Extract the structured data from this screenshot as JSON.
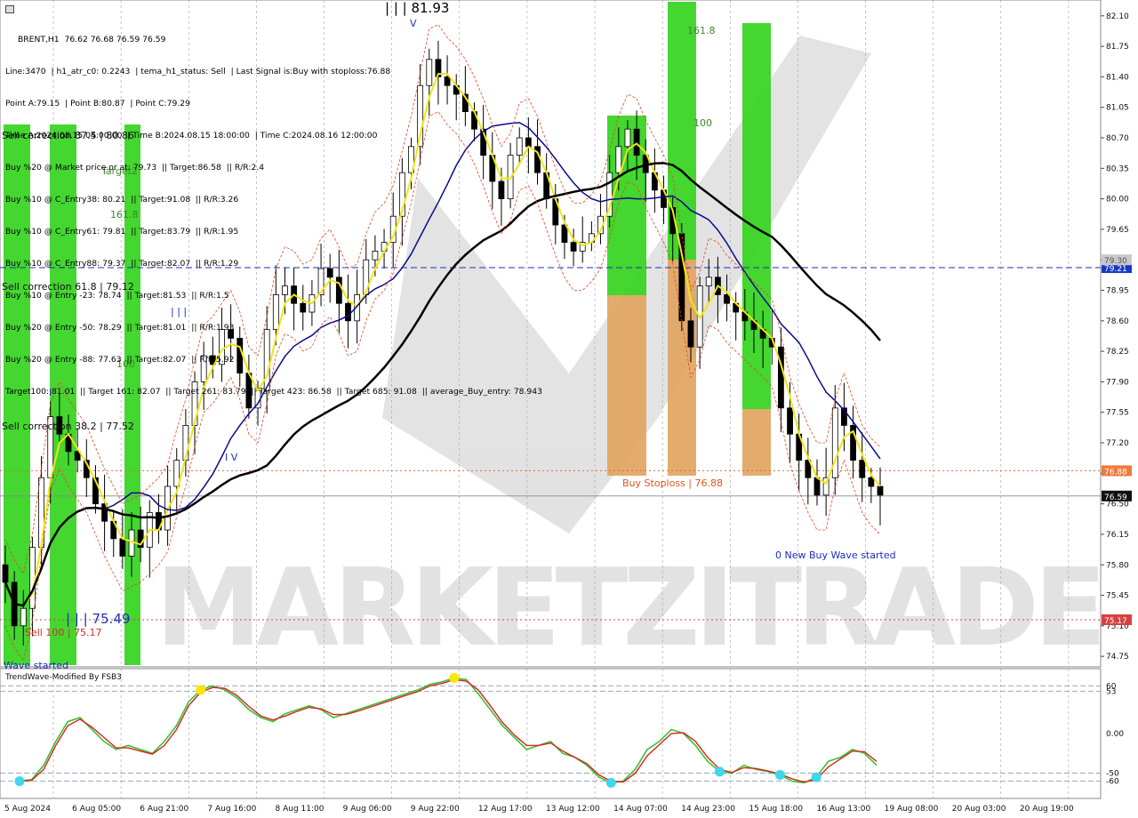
{
  "info_lines": [
    "BRENT,H1  76.62 76.68 76.59 76.59",
    "Line:3470  | h1_atr_c0: 0.2243  | tema_h1_status: Sell  | Last Signal is:Buy with stoploss:76.88",
    "Point A:79.15  | Point B:80.87  | Point C:79.29",
    "Time A:2024.08.15 04:00:00  | Time B:2024.08.15 18:00:00  | Time C:2024.08.16 12:00:00",
    "Buy %20 @ Market price or at: 79.73  || Target:86.58  || R/R:2.4",
    "Buy %10 @ C_Entry38: 80.21  || Target:91.08  || R/R:3.26",
    "Buy %10 @ C_Entry61: 79.81  || Target:83.79  || R/R:1.95",
    "Buy %10 @ C_Entry88: 79.37  || Target:82.07  || R/R:1.29",
    "Buy %10 @ Entry -23: 78.74  || Target:81.53  || R/R:1.5",
    "Buy %20 @ Entry -50: 78.29  || Target:81.01  || R/R:1.93",
    "Buy %20 @ Entry -88: 77.63  || Target:82.07  || R/R:5.92",
    "Target100: 81.01  || Target 161: 82.07  || Target 261: 83.79  || Target 423: 86.58  || Target 685: 91.08  || average_Buy_entry: 78.943"
  ],
  "colors": {
    "background": "#ffffff",
    "grid": "#9ca3ad",
    "candle": "#000000",
    "green_zone": "#2fd318",
    "orange_zone": "#e0a35c",
    "ema_fast": "#f0e516",
    "ema_mid": "#0a0a8c",
    "ema_slow": "#000000",
    "envelope": "#e8441e",
    "dashed_blue": "#1b2fbf",
    "stop_line": "#e46a3c",
    "osc_green": "#35c435",
    "osc_red": "#e02020",
    "price_tag_blue": "#1638c8",
    "price_tag_orange": "#f07a3c",
    "price_tag_red": "#d84040",
    "price_tag_dark": "#111111",
    "watermark": "#808080"
  },
  "chart_data": [
    {
      "type": "candlestick",
      "symbol": "BRENT,H1",
      "ylim": [
        74.67,
        82.2
      ],
      "y_ticks": [
        "82.10",
        "81.75",
        "81.40",
        "81.05",
        "80.70",
        "80.35",
        "80.00",
        "79.65",
        "79.30",
        "78.95",
        "78.60",
        "78.25",
        "77.90",
        "77.55",
        "77.20",
        "76.85",
        "76.50",
        "76.15",
        "75.80",
        "75.45",
        "75.10",
        "74.75"
      ],
      "x_ticks": [
        "5 Aug 2024",
        "6 Aug 05:00",
        "6 Aug 21:00",
        "7 Aug 16:00",
        "8 Aug 11:00",
        "9 Aug 06:00",
        "9 Aug 22:00",
        "12 Aug 17:00",
        "13 Aug 12:00",
        "14 Aug 07:00",
        "14 Aug 23:00",
        "15 Aug 18:00",
        "16 Aug 13:00",
        "19 Aug 08:00",
        "20 Aug 03:00",
        "20 Aug 19:00"
      ],
      "price_tags": [
        {
          "value": 79.21,
          "label": "79.21",
          "style": "blue"
        },
        {
          "value": 79.3,
          "label": "79.30",
          "style": "faint"
        },
        {
          "value": 76.88,
          "label": "76.88",
          "style": "orange"
        },
        {
          "value": 76.59,
          "label": "76.59",
          "style": "dark"
        },
        {
          "value": 75.17,
          "label": "75.17",
          "style": "red"
        }
      ],
      "horizontal_lines": [
        {
          "value": 79.21,
          "style": "dashed_blue"
        },
        {
          "value": 76.88,
          "style": "dotted_orange"
        },
        {
          "value": 76.59,
          "style": "solid_gray"
        },
        {
          "value": 75.17,
          "style": "dotted_red"
        }
      ],
      "ohlc_close_path": [
        75.6,
        75.1,
        75.3,
        76.0,
        76.8,
        77.5,
        77.3,
        77.1,
        77.0,
        76.8,
        76.5,
        76.3,
        76.1,
        75.9,
        76.2,
        76.0,
        76.4,
        76.2,
        76.7,
        77.0,
        77.4,
        77.9,
        78.2,
        78.1,
        78.5,
        78.4,
        78.0,
        77.6,
        77.8,
        78.5,
        78.9,
        79.0,
        78.8,
        78.7,
        78.9,
        79.2,
        79.1,
        78.8,
        78.6,
        78.9,
        79.3,
        79.4,
        79.5,
        79.8,
        80.3,
        80.6,
        81.3,
        81.6,
        81.4,
        81.3,
        81.2,
        81.0,
        80.8,
        80.5,
        80.2,
        80.0,
        80.5,
        80.7,
        80.6,
        80.3,
        80.0,
        79.7,
        79.5,
        79.4,
        79.5,
        79.6,
        79.8,
        80.3,
        80.6,
        80.8,
        80.5,
        80.3,
        80.1,
        79.9,
        79.6,
        78.6,
        78.3,
        79.0,
        79.1,
        78.9,
        78.8,
        78.7,
        78.6,
        78.5,
        78.4,
        78.3,
        77.6,
        77.3,
        77.0,
        76.8,
        76.6,
        76.8,
        77.6,
        77.4,
        77.0,
        76.8,
        76.7,
        76.6
      ],
      "labels_on_chart": [
        {
          "text": "| | | 81.93",
          "color": "#000000"
        },
        {
          "text": "V",
          "color": "#1b2fbf"
        },
        {
          "text": "161.8",
          "color": "#3a8a2a"
        },
        {
          "text": "100",
          "color": "#3a8a2a"
        },
        {
          "text": "Target2",
          "color": "#3a8a2a"
        },
        {
          "text": "161.8",
          "color": "#3a8a2a"
        },
        {
          "text": "100",
          "color": "#3a8a2a"
        },
        {
          "text": "Sell correction 87.5 | 80.86",
          "color": "#111111"
        },
        {
          "text": "Sell correction 61.8 | 79.12",
          "color": "#111111"
        },
        {
          "text": "Sell correction 38.2 | 77.52",
          "color": "#111111"
        },
        {
          "text": "Sell 100 | 75.17",
          "color": "#d03020"
        },
        {
          "text": "| | | 75.49",
          "color": "#1b2fbf"
        },
        {
          "text": "Wave started",
          "color": "#1b2fbf"
        },
        {
          "text": "| | |",
          "color": "#1b2fbf"
        },
        {
          "text": "I V",
          "color": "#1b2fbf"
        },
        {
          "text": "I",
          "color": "#1b2fbf"
        },
        {
          "text": "Buy Stoploss | 76.88",
          "color": "#e0551e"
        },
        {
          "text": "0 New Buy Wave started",
          "color": "#1b2fbf"
        }
      ],
      "watermark": "MARKETZITRADE"
    },
    {
      "type": "line",
      "title": "TrendWave-Modified By FSB3",
      "ylim": [
        -75,
        75
      ],
      "y_ticks": [
        "60",
        "53",
        "0.00",
        "-50",
        "-60"
      ],
      "dashed_levels": [
        60,
        53,
        -50,
        -60
      ],
      "series_green": [
        -60,
        -58,
        -40,
        -10,
        15,
        20,
        5,
        -10,
        -20,
        -15,
        -20,
        -25,
        -10,
        10,
        40,
        55,
        60,
        55,
        45,
        30,
        20,
        15,
        25,
        30,
        35,
        30,
        20,
        25,
        30,
        35,
        40,
        45,
        50,
        55,
        62,
        65,
        70,
        68,
        50,
        30,
        10,
        -5,
        -20,
        -15,
        -10,
        -25,
        -30,
        -40,
        -55,
        -62,
        -60,
        -45,
        -20,
        -10,
        5,
        0,
        -15,
        -35,
        -48,
        -50,
        -40,
        -45,
        -48,
        -52,
        -60,
        -62,
        -55,
        -35,
        -30,
        -20,
        -25,
        -40
      ],
      "series_red": [
        -60,
        -59,
        -45,
        -15,
        10,
        18,
        8,
        -5,
        -18,
        -18,
        -22,
        -26,
        -15,
        5,
        35,
        52,
        58,
        57,
        48,
        34,
        22,
        17,
        22,
        28,
        33,
        31,
        24,
        24,
        28,
        33,
        38,
        43,
        48,
        53,
        60,
        63,
        68,
        66,
        55,
        35,
        14,
        -2,
        -15,
        -15,
        -12,
        -22,
        -30,
        -38,
        -52,
        -60,
        -61,
        -50,
        -28,
        -14,
        0,
        1,
        -10,
        -30,
        -45,
        -49,
        -43,
        -44,
        -47,
        -51,
        -57,
        -61,
        -58,
        -42,
        -32,
        -22,
        -23,
        -35
      ],
      "markers": [
        {
          "index": 0,
          "color": "#3fd6ee"
        },
        {
          "index": 15,
          "color": "#ffe600"
        },
        {
          "index": 36,
          "color": "#ffe600"
        },
        {
          "index": 49,
          "color": "#3fd6ee"
        },
        {
          "index": 58,
          "color": "#3fd6ee"
        },
        {
          "index": 63,
          "color": "#3fd6ee"
        },
        {
          "index": 66,
          "color": "#3fd6ee"
        }
      ]
    }
  ]
}
